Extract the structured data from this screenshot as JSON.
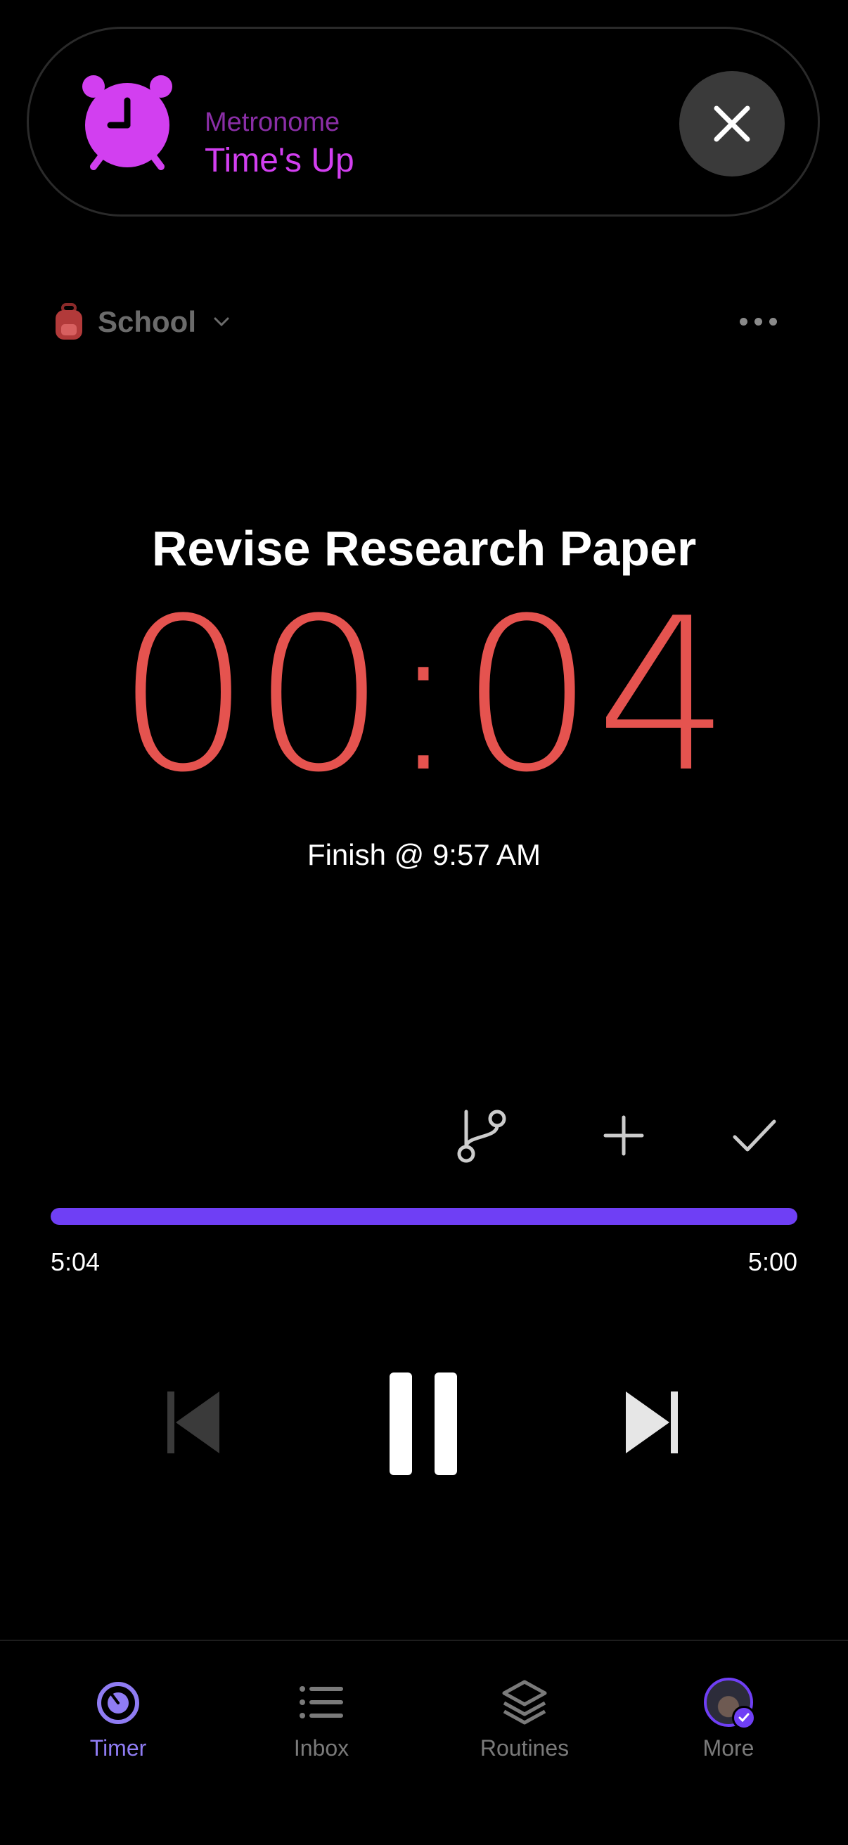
{
  "notification": {
    "app_name": "Metronome",
    "title": "Time's Up",
    "app_icon": "alarm-clock-icon",
    "close_icon": "close-icon",
    "accent_color": "#d23ff0"
  },
  "header": {
    "project_label": "School",
    "project_icon": "backpack-icon",
    "dropdown_icon": "chevron-down-icon",
    "menu_icon": "more-dots-icon"
  },
  "timer": {
    "task_title": "Revise Research Paper",
    "time": "00:04",
    "finish_text": "Finish @ 9:57 AM",
    "time_color": "#e5534f"
  },
  "actions": {
    "branch_icon": "branch-icon",
    "add_icon": "plus-icon",
    "complete_icon": "check-icon"
  },
  "progress": {
    "value_percent": 100,
    "left_label": "5:04",
    "right_label": "5:00",
    "fill_color": "#6f3ff5"
  },
  "controls": {
    "previous_icon": "skip-previous-icon",
    "pause_icon": "pause-icon",
    "next_icon": "skip-next-icon"
  },
  "tabs": [
    {
      "label": "Timer",
      "icon": "timer-icon",
      "active": true
    },
    {
      "label": "Inbox",
      "icon": "list-icon",
      "active": false
    },
    {
      "label": "Routines",
      "icon": "layers-icon",
      "active": false
    },
    {
      "label": "More",
      "icon": "avatar",
      "active": false
    }
  ]
}
